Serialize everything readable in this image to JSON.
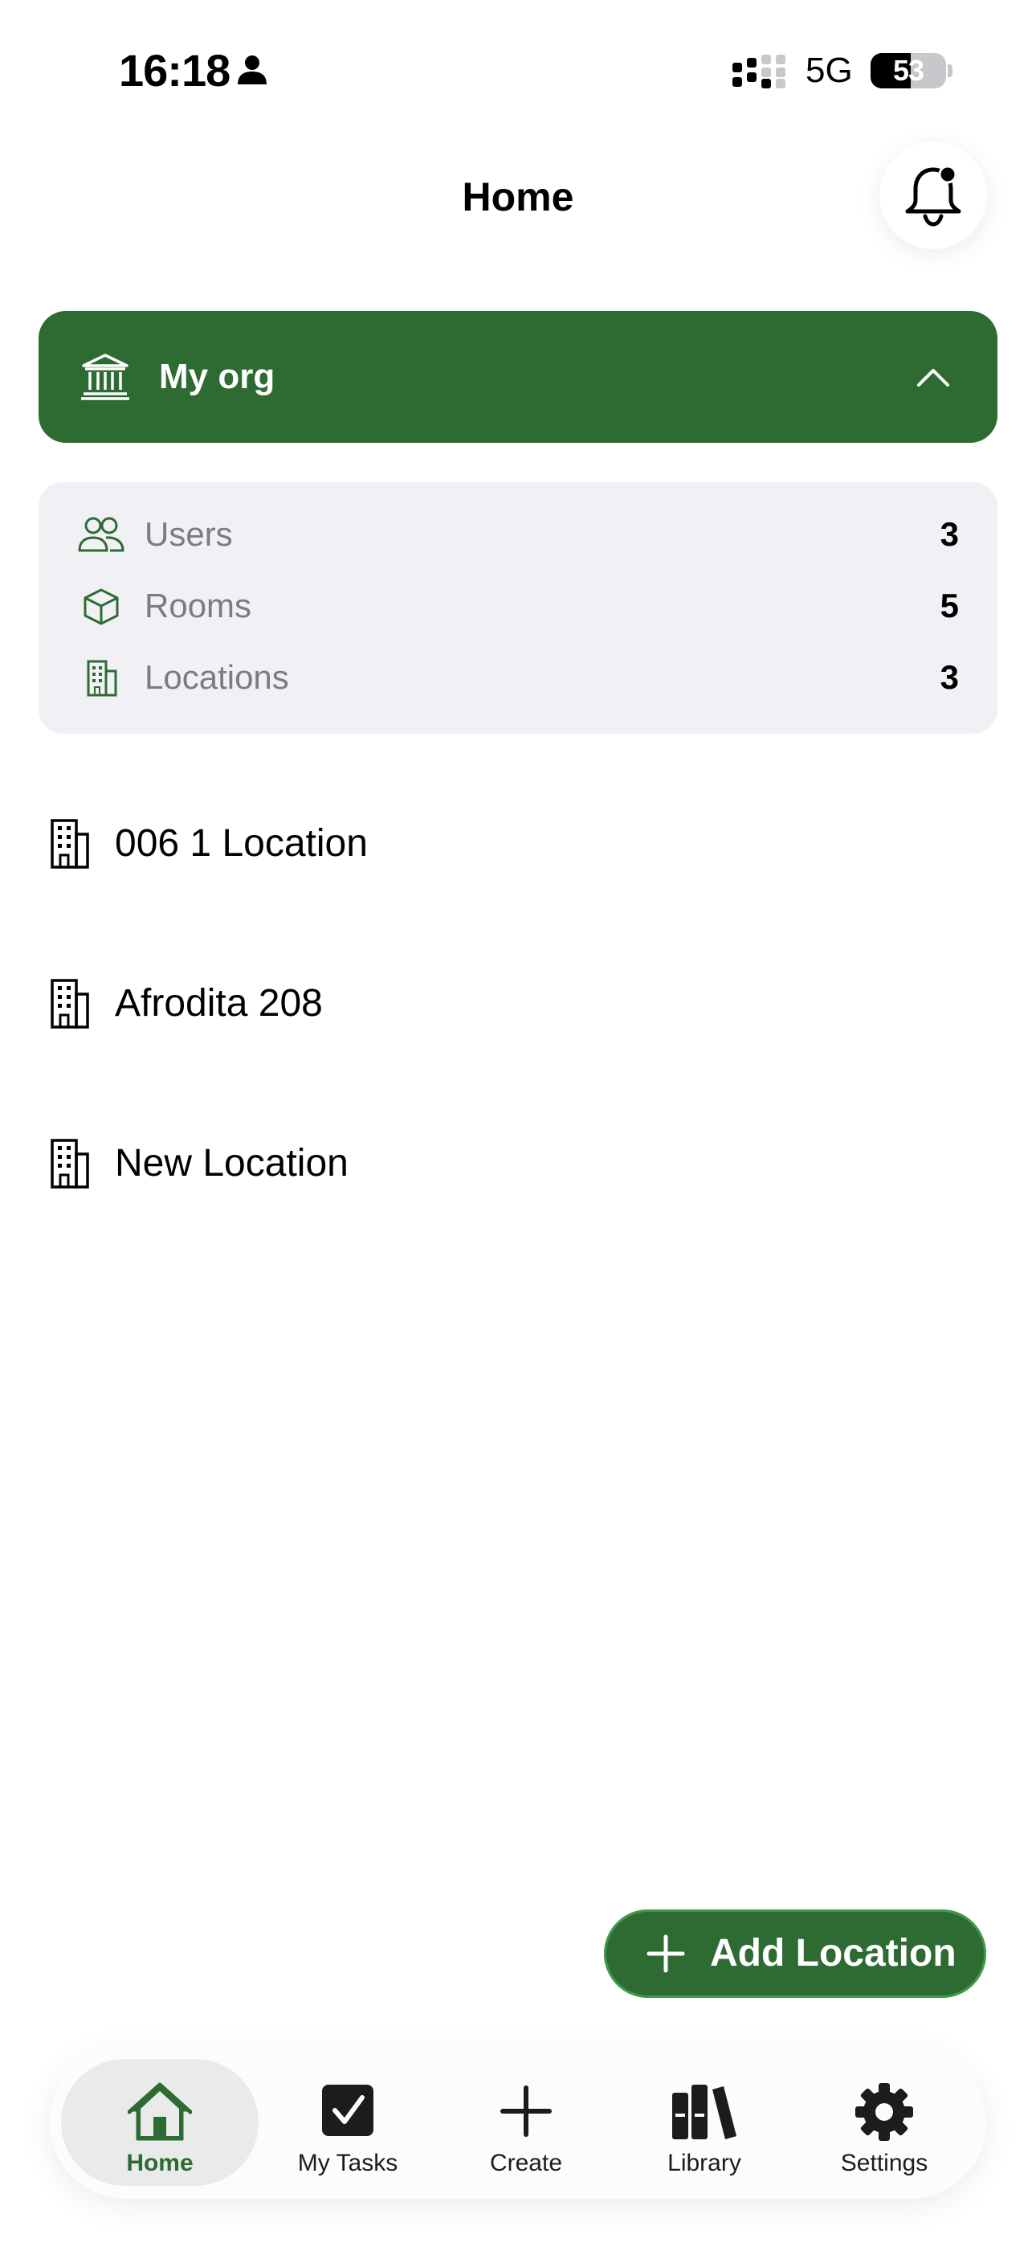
{
  "status_bar": {
    "time": "16:18",
    "network": "5G",
    "battery": "53",
    "battery_level": 0.53
  },
  "header": {
    "title": "Home"
  },
  "org": {
    "name": "My org"
  },
  "stats": [
    {
      "label": "Users",
      "value": "3",
      "icon": "users-icon"
    },
    {
      "label": "Rooms",
      "value": "5",
      "icon": "cube-icon"
    },
    {
      "label": "Locations",
      "value": "3",
      "icon": "building-icon"
    }
  ],
  "locations": [
    {
      "name": "006 1 Location"
    },
    {
      "name": "Afrodita 208"
    },
    {
      "name": "New Location"
    }
  ],
  "add_button": {
    "label": "Add Location"
  },
  "tabs": [
    {
      "label": "Home",
      "icon": "home-icon",
      "active": true
    },
    {
      "label": "My Tasks",
      "icon": "checkbox-icon",
      "active": false
    },
    {
      "label": "Create",
      "icon": "plus-icon",
      "active": false
    },
    {
      "label": "Library",
      "icon": "books-icon",
      "active": false
    },
    {
      "label": "Settings",
      "icon": "gear-icon",
      "active": false
    }
  ],
  "colors": {
    "accent": "#2e6b32",
    "card_bg": "#f1f1f5",
    "muted_text": "#7b7b80"
  }
}
